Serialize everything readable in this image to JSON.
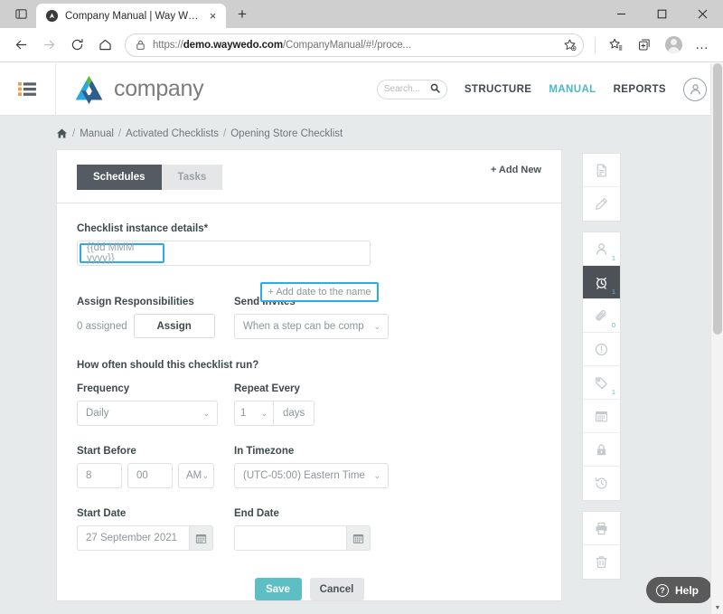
{
  "browser": {
    "tab": {
      "title": "Company Manual | Way We Do",
      "favicon_name": "waywedo-favicon",
      "close_label": "×"
    },
    "new_tab_label": "+",
    "window_controls": {
      "minimize": "–",
      "maximize": "□",
      "close": "✕"
    },
    "nav": {
      "back": "←",
      "forward": "→",
      "reload": "↻",
      "home": "⌂"
    },
    "url_prefix": "https://",
    "url_domain": "demo.waywedo.com",
    "url_path": "/CompanyManual/#!/proce...",
    "toolbar_icons": [
      "favorite-icon",
      "collections-icon",
      "profile-icon",
      "settings-more-icon"
    ],
    "more_label": "…"
  },
  "app": {
    "brand_name": "company",
    "search": {
      "placeholder": "Search...",
      "value": ""
    },
    "nav_links": [
      {
        "label": "STRUCTURE",
        "active": false
      },
      {
        "label": "MANUAL",
        "active": true
      },
      {
        "label": "REPORTS",
        "active": false
      }
    ],
    "accent_color": "#4cb8c4"
  },
  "breadcrumb": {
    "home_icon": "home-icon",
    "separator": "/",
    "items": [
      "Manual",
      "Activated Checklists",
      "Opening Store Checklist"
    ]
  },
  "card": {
    "tabs": [
      {
        "label": "Schedules",
        "active": true
      },
      {
        "label": "Tasks",
        "active": false
      }
    ],
    "add_new_label": "+ Add New"
  },
  "form": {
    "instance_details": {
      "label": "Checklist instance details*",
      "value": "{{dd MMM yyyy}}",
      "highlighted": true,
      "add_date_button": "+ Add date to the name",
      "highlight_color": "#2aacea"
    },
    "assign": {
      "label": "Assign Responsibilities",
      "count_text": "0 assigned",
      "button_label": "Assign"
    },
    "send_invites": {
      "label": "Send Invites",
      "value": "When a step can be comp",
      "caret": "⌄"
    },
    "frequency_question": "How often should this checklist run?",
    "frequency": {
      "label": "Frequency",
      "value": "Daily",
      "caret": "⌄"
    },
    "repeat_every": {
      "label": "Repeat Every",
      "value": "1",
      "unit": "days",
      "caret": "⌄"
    },
    "start_before": {
      "label": "Start Before",
      "hour": "8",
      "minute": "00",
      "meridiem": "AM",
      "caret": "⌄"
    },
    "timezone": {
      "label": "In Timezone",
      "value": "(UTC-05:00) Eastern Time",
      "caret": "⌄"
    },
    "start_date": {
      "label": "Start Date",
      "value": "27 September 2021",
      "picker_icon": "calendar-icon"
    },
    "end_date": {
      "label": "End Date",
      "value": "",
      "picker_icon": "calendar-icon"
    },
    "save_label": "Save",
    "cancel_label": "Cancel",
    "save_color": "#5dbec4"
  },
  "rail": {
    "groups": [
      {
        "buttons": [
          {
            "name": "document-icon",
            "badge": "",
            "active": false
          },
          {
            "name": "pencil-icon",
            "badge": "",
            "active": false
          }
        ]
      },
      {
        "buttons": [
          {
            "name": "person-icon",
            "badge": "1",
            "active": false
          },
          {
            "name": "alarm-clock-icon",
            "badge": "1",
            "active": true
          },
          {
            "name": "paperclip-icon",
            "badge": "0",
            "active": false
          },
          {
            "name": "exclamation-circle-icon",
            "badge": "",
            "active": false
          },
          {
            "name": "tag-icon",
            "badge": "1",
            "active": false
          },
          {
            "name": "calendar-icon",
            "badge": "",
            "active": false
          },
          {
            "name": "lock-icon",
            "badge": "",
            "active": false
          },
          {
            "name": "history-icon",
            "badge": "",
            "active": false
          }
        ]
      },
      {
        "buttons": [
          {
            "name": "printer-icon",
            "badge": "",
            "active": false
          },
          {
            "name": "trash-icon",
            "badge": "",
            "active": false
          }
        ]
      }
    ]
  },
  "help": {
    "label": "Help",
    "icon_glyph": "?"
  }
}
